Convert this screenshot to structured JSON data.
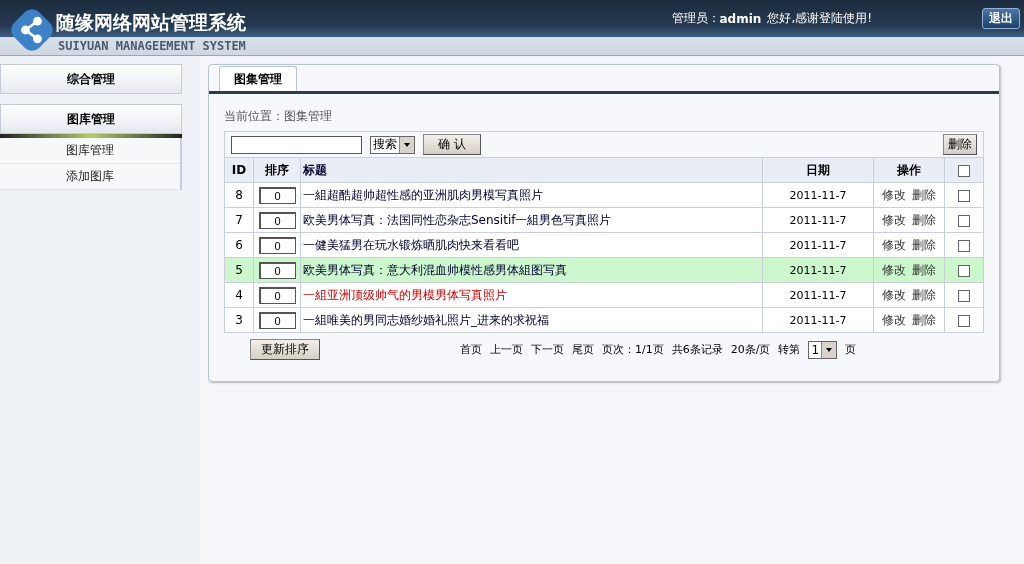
{
  "header": {
    "title": "随缘网络网站管理系统",
    "subtitle": "SUIYUAN MANAGEEMENT SYSTEM",
    "admin_label": "管理员：",
    "admin_name": "admin",
    "greeting": "您好,感谢登陆使用!",
    "logout": "退出"
  },
  "sidebar": {
    "sections": [
      {
        "label": "综合管理",
        "expanded": false
      },
      {
        "label": "图库管理",
        "expanded": true,
        "items": [
          "图库管理",
          "添加图库"
        ]
      }
    ]
  },
  "tabs": [
    {
      "label": "图集管理",
      "selected": true
    }
  ],
  "breadcrumb": "当前位置：图集管理",
  "toolbar": {
    "search_select": "搜索",
    "confirm": "确 认",
    "delete": "删除"
  },
  "table": {
    "columns": [
      "ID",
      "排序",
      "标题",
      "日期",
      "操作"
    ],
    "rows": [
      {
        "id": "8",
        "order": "0",
        "title": "一組超酷超帅超性感的亚洲肌肉男模写真照片",
        "date": "2011-11-7",
        "edit": "修改",
        "del": "删除",
        "checked": false,
        "selected": false,
        "emphasized": false
      },
      {
        "id": "7",
        "order": "0",
        "title": "欧美男体写真：法国同性恋杂志Sensitif一組男色写真照片",
        "date": "2011-11-7",
        "edit": "修改",
        "del": "删除",
        "checked": false,
        "selected": false,
        "emphasized": false
      },
      {
        "id": "6",
        "order": "0",
        "title": "一健美猛男在玩水锻炼晒肌肉快来看看吧",
        "date": "2011-11-7",
        "edit": "修改",
        "del": "删除",
        "checked": false,
        "selected": false,
        "emphasized": false
      },
      {
        "id": "5",
        "order": "0",
        "title": "欧美男体写真：意大利混血帅模性感男体組图写真",
        "date": "2011-11-7",
        "edit": "修改",
        "del": "删除",
        "checked": false,
        "selected": true,
        "emphasized": false
      },
      {
        "id": "4",
        "order": "0",
        "title": "一組亚洲顶级帅气的男模男体写真照片",
        "date": "2011-11-7",
        "edit": "修改",
        "del": "删除",
        "checked": false,
        "selected": false,
        "emphasized": true
      },
      {
        "id": "3",
        "order": "0",
        "title": "一組唯美的男同志婚纱婚礼照片_进来的求祝福",
        "date": "2011-11-7",
        "edit": "修改",
        "del": "删除",
        "checked": false,
        "selected": false,
        "emphasized": false
      }
    ],
    "select_all_checked": false
  },
  "footer": {
    "update_order": "更新排序",
    "links": [
      "首页",
      "上一页",
      "下一页",
      "尾页"
    ],
    "page_info": "页次：1/1页",
    "total": "共6条记录",
    "per_page": "20条/页",
    "goto": "转第",
    "page_select": "1",
    "page_unit": "页"
  }
}
